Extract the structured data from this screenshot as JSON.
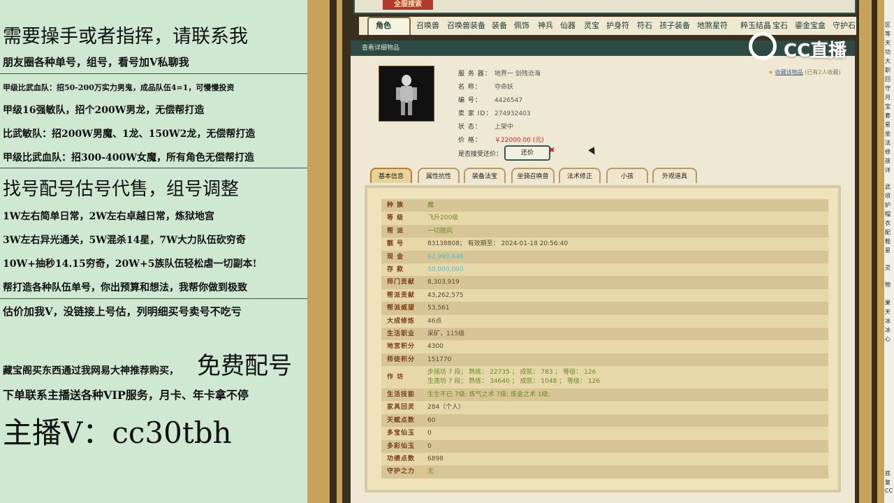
{
  "promo": {
    "lines": [
      "需要操手或者指挥，请联系我",
      "朋友圈各种单号，组号，看号加V私聊我",
      "甲级比武血队：招50-200万实力男鬼，成品队伍4=1，可慢慢投资",
      "甲级16强敏队，招个200W男龙，无偿帮打造",
      "比武敏队：招200W男魔、1龙、150W2龙，无偿帮打造",
      "甲级比武血队：招300-400W女魔，所有角色无偿帮打造",
      "找号配号估号代售，组号调整",
      "1W左右简单日常，2W左右卓越日常，炼狱地宫",
      "3W左右异光通关，5W混杀14星，7W大力队伍砍穷奇",
      "10W+抽秒14.15穷奇，20W+5族队伍轻松虐一切副本!",
      "帮打造各种队伍单号，你出预算和想法，我帮你做到极致",
      "估价加我V，没链接上号估，列明细买号卖号不吃亏",
      "藏宝阁买东西通过我网易大神推荐购买，",
      "免费配号",
      "下单联系主播送各种VIP服务，月卡、年卡拿不停",
      "主播V：cc30tbh"
    ]
  },
  "game": {
    "logo": "全服搜索",
    "tabs": [
      "角色",
      "召唤兽",
      "召唤兽装备",
      "装备",
      "佩饰",
      "神兵",
      "仙器",
      "灵宝",
      "护身符",
      "符石",
      "孩子装备",
      "地煞星符",
      "粹玉结晶",
      "宝石",
      "鎏金宝盒",
      "守护石"
    ],
    "header": "查看详细物品",
    "info": [
      {
        "k": "服 务 器：",
        "v": "地界一 剑残沧海"
      },
      {
        "k": "名   称：",
        "v": "夺命妖"
      },
      {
        "k": "编   号：",
        "v": "4426547"
      },
      {
        "k": "卖 家 ID：",
        "v": "274932403"
      },
      {
        "k": "状   态：",
        "v": "上架中"
      },
      {
        "k": "价   格：",
        "v": "￥22000.00 (元)"
      }
    ],
    "haggle_label": "是否接受还价：",
    "haggle_button": "还价",
    "favorite_link": "收藏该物品",
    "favorite_count": "(已有2人收藏)",
    "subtabs": [
      "基本信息",
      "属性抗性",
      "装备法宝",
      "坐骑召唤兽",
      "法术修正",
      "小孩",
      "外观道具"
    ],
    "rows": [
      {
        "k": "种  族",
        "v": "魔",
        "c": "green"
      },
      {
        "k": "等  级",
        "v": "飞升200级",
        "c": "green"
      },
      {
        "k": "帮  派",
        "v": "一切随风",
        "c": "green"
      },
      {
        "k": "靓  号",
        "v": "83138808；  有效期至：  2024-01-18 20:56:40",
        "c": ""
      },
      {
        "k": "现  金",
        "v": "62,990,648",
        "c": "cyan"
      },
      {
        "k": "存  款",
        "v": "50,000,000",
        "c": "cyan"
      },
      {
        "k": "师门贡献",
        "v": "8,303,919",
        "c": ""
      },
      {
        "k": "帮派贡献",
        "v": "43,262,575",
        "c": ""
      },
      {
        "k": "帮派威望",
        "v": "53,561",
        "c": ""
      },
      {
        "k": "大成修炼",
        "v": "46点",
        "c": ""
      },
      {
        "k": "生活职业",
        "v": "采矿，115级",
        "c": ""
      },
      {
        "k": "地宫积分",
        "v": "4300",
        "c": ""
      },
      {
        "k": "师徒积分",
        "v": "151770",
        "c": ""
      }
    ],
    "workshop": {
      "k": "作  坊",
      "l1": "步摇坊 7 段；  熟练： 22735 ；  成就： 783 ；  等级： 126",
      "l2": "生莲坊 7 段；  熟练： 34640 ；  成就： 1048 ；  等级： 126"
    },
    "rows2": [
      {
        "k": "生活技能",
        "v": "生生不已 7级; 炼气之术 7级; 炼金之术 1级;",
        "c": "green"
      },
      {
        "k": "家具回灵",
        "v": "284（个人）",
        "c": ""
      },
      {
        "k": "天赋点数",
        "v": "60",
        "c": ""
      },
      {
        "k": "多宝仙玉",
        "v": "0",
        "c": ""
      },
      {
        "k": "多彩仙玉",
        "v": "0",
        "c": ""
      },
      {
        "k": "功绩点数",
        "v": "6898",
        "c": ""
      },
      {
        "k": "守护之力",
        "v": "无",
        "c": "green"
      }
    ]
  },
  "watermark": "CC直播",
  "right_list": [
    "区",
    "等",
    "天",
    "功",
    "大",
    "职",
    "回",
    "守",
    "月",
    "宝",
    "套",
    "星",
    "坐",
    "法",
    "修",
    "孩",
    "详",
    "武",
    "项",
    "护",
    "帽",
    "衣",
    "配",
    "鞋",
    "星",
    "灵",
    "物",
    "果",
    "天",
    "冰",
    "冰",
    "心",
    "底",
    "复",
    "CC"
  ]
}
